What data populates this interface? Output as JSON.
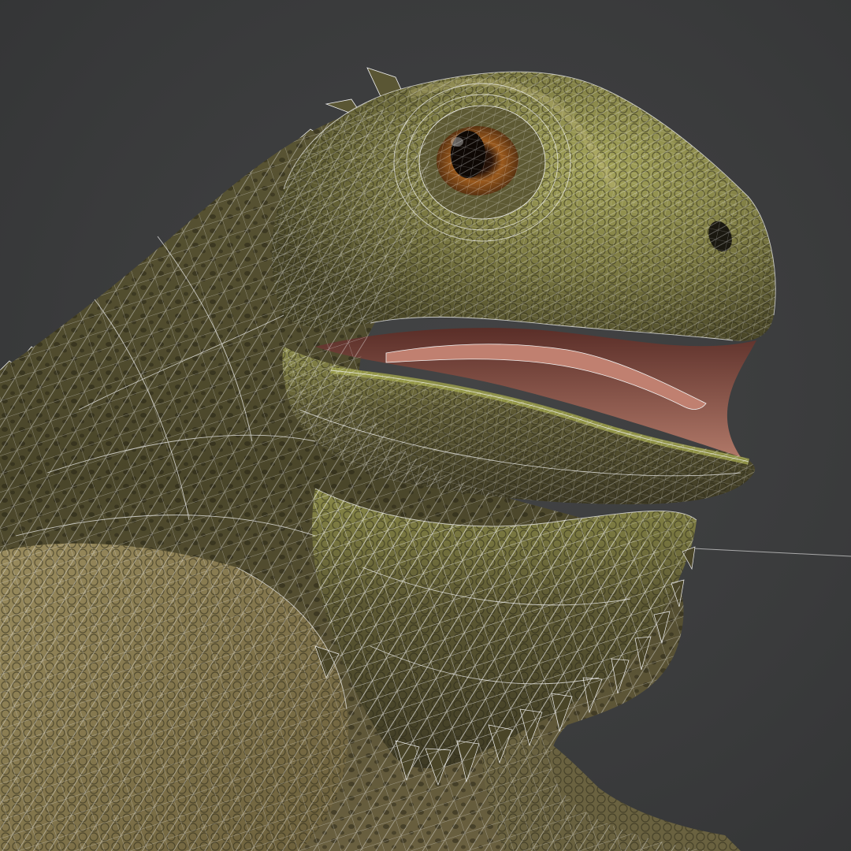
{
  "scene": {
    "subject": "lizard-wireframe-render",
    "colors": {
      "background": "#3b3c3d",
      "skin_light": "#9a9a52",
      "skin_mid": "#6e6c3c",
      "skin_dark": "#3a3722",
      "belly": "#8a7c52",
      "mouth": "#b07868",
      "tongue": "#c08070",
      "eye_iris": "#9a5a1e",
      "wire": "#f2f2f2"
    }
  }
}
